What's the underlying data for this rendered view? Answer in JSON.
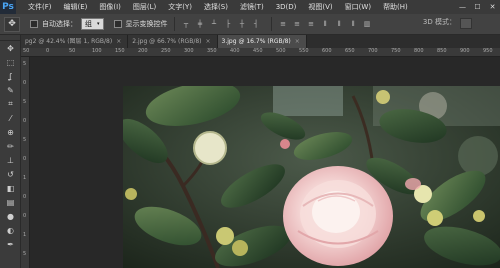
{
  "app": {
    "logo": "Ps"
  },
  "menu": [
    "文件(F)",
    "编辑(E)",
    "图像(I)",
    "图层(L)",
    "文字(Y)",
    "选择(S)",
    "滤镜(T)",
    "3D(D)",
    "视图(V)",
    "窗口(W)",
    "帮助(H)"
  ],
  "window_controls": {
    "minimize": "—",
    "maximize": "☐",
    "close": "✕"
  },
  "options": {
    "tool_icon": "move-tool-icon",
    "auto_select_label": "自动选择：",
    "auto_select_value": "组",
    "show_transform_label": "显示变换控件",
    "mode3d_label": "3D 模式："
  },
  "tabs": [
    {
      "label": "pg2 @ 42.4% (图层 1, RGB/8)",
      "close": "×",
      "active": false
    },
    {
      "label": "2.jpg @ 66.7% (RGB/8)",
      "close": "×",
      "active": false
    },
    {
      "label": "3.jpg @ 16.7% (RGB/8)",
      "close": "×",
      "active": true
    }
  ],
  "tools": [
    "move-icon",
    "marquee-icon",
    "lasso-icon",
    "quick-select-icon",
    "crop-icon",
    "eyedropper-icon",
    "healing-brush-icon",
    "brush-icon",
    "clone-stamp-icon",
    "history-brush-icon",
    "eraser-icon",
    "gradient-icon",
    "blur-icon",
    "dodge-icon",
    "pen-icon"
  ],
  "tool_glyphs": [
    "✥",
    "⬚",
    "ʆ",
    "✎",
    "⌗",
    "⁄",
    "⊕",
    "✏",
    "⊥",
    "↺",
    "◧",
    "▤",
    "●",
    "◐",
    "✒"
  ],
  "ruler_top": [
    "50",
    "0",
    "50",
    "100",
    "150",
    "200",
    "250",
    "300",
    "350",
    "400",
    "450",
    "500",
    "550",
    "600",
    "650",
    "700",
    "750",
    "800",
    "850",
    "900",
    "950"
  ],
  "ruler_left": [
    "5",
    "0",
    "5",
    "0",
    "5",
    "0",
    "1",
    "0",
    "0",
    "1",
    "5"
  ],
  "colors": {
    "accent": "#4aa5f5",
    "panel": "#3b3b3b",
    "canvas_bg": "#282828"
  }
}
